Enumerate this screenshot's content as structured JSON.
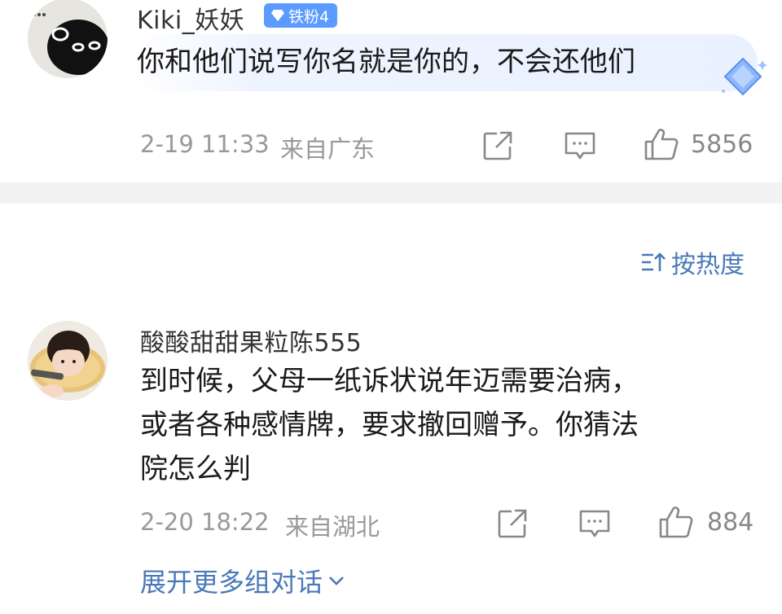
{
  "comments": [
    {
      "username": "Kiki_妖妖",
      "badge": "铁粉4",
      "text": "你和他们说写你名就是你的，不会还他们",
      "time": "2-19 11:33",
      "location": "来自广东",
      "likes": "5856"
    },
    {
      "username": "酸酸甜甜果粒陈555",
      "text_lines": [
        "到时候，父母一纸诉状说年迈需要治病，",
        "或者各种感情牌，要求撤回赠予。你猜法",
        "院怎么判"
      ],
      "time": "2-20 18:22",
      "location": "来自湖北",
      "likes": "884"
    }
  ],
  "sort": {
    "label": "按热度",
    "icon": "sort-icon"
  },
  "expand": {
    "label": "展开更多组对话",
    "icon": "chevron-down-icon"
  },
  "colors": {
    "link": "#4a78b8",
    "meta": "#999999",
    "badge": "#5b9bff",
    "divider": "#f2f2f2"
  }
}
